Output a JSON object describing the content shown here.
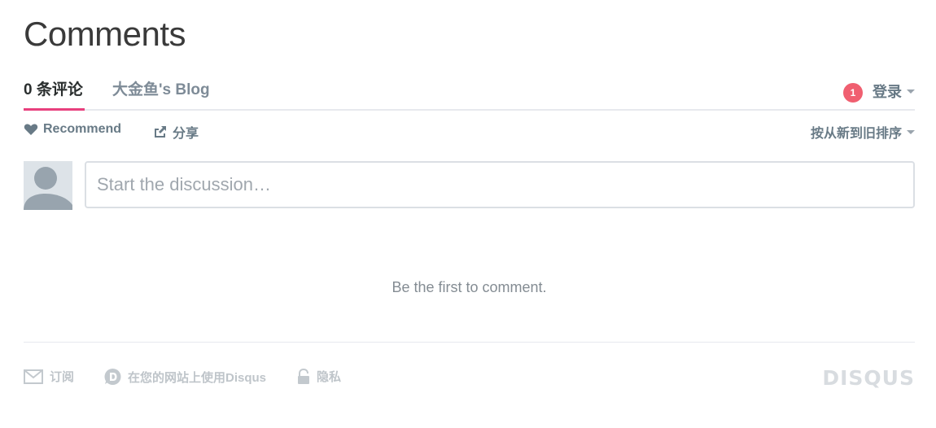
{
  "header": {
    "title": "Comments"
  },
  "nav": {
    "tabs": [
      {
        "label": "0 条评论",
        "active": true
      },
      {
        "label": "大金鱼's Blog",
        "active": false
      }
    ],
    "notification_count": "1",
    "login_label": "登录"
  },
  "actions": {
    "recommend_label": "Recommend",
    "share_label": "分享",
    "sort_label": "按从新到旧排序"
  },
  "composer": {
    "placeholder": "Start the discussion…"
  },
  "empty_state": {
    "message": "Be the first to comment."
  },
  "footer": {
    "subscribe_label": "订阅",
    "add_disqus_label": "在您的网站上使用Disqus",
    "privacy_label": "隐私",
    "brand": "DISQUS"
  },
  "colors": {
    "accent": "#e8407d",
    "notification": "#f05f70",
    "muted_text": "#687a86"
  },
  "icons": [
    "heart-icon",
    "share-icon",
    "caret-down-icon",
    "avatar-placeholder-icon",
    "mail-icon",
    "disqus-logo-icon",
    "lock-icon"
  ]
}
